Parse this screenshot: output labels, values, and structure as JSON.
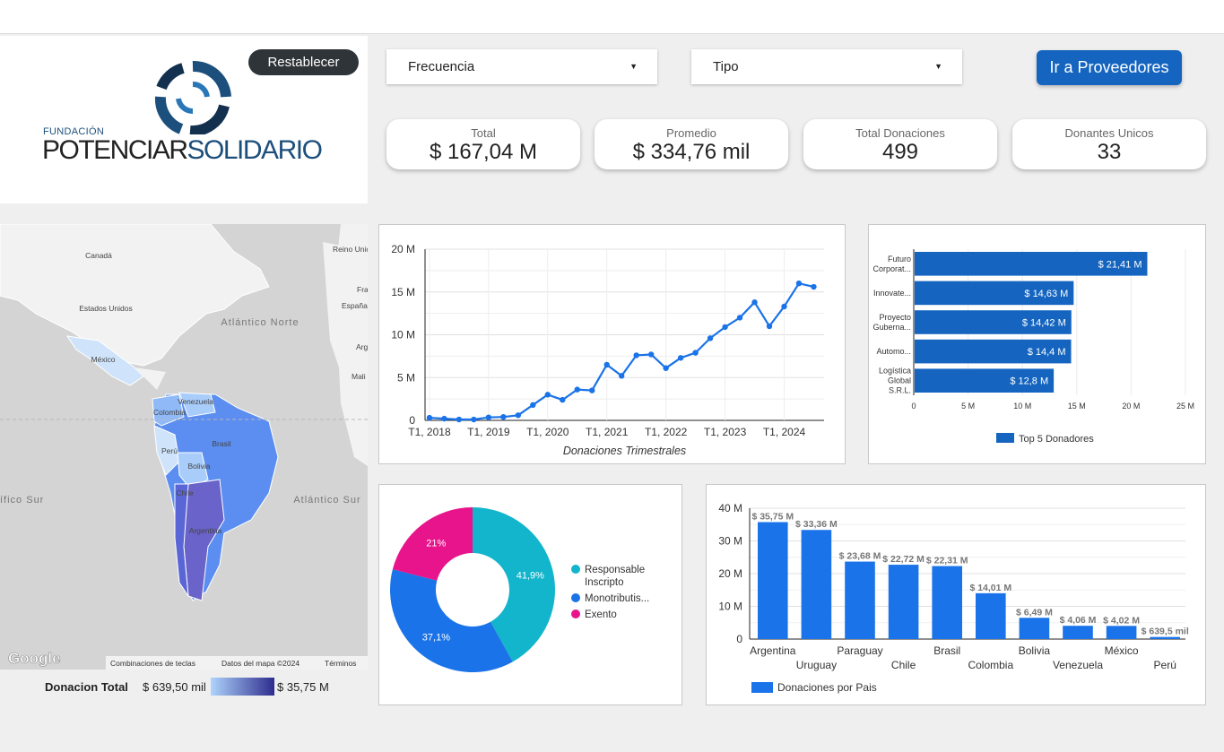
{
  "buttons": {
    "reset": "Restablecer",
    "goto": "Ir a Proveedores"
  },
  "logo": {
    "small": "FUNDACIÓN",
    "main": "POTENCIAR",
    "accent": "SOLIDARIO"
  },
  "filters": {
    "freq": "Frecuencia",
    "type": "Tipo"
  },
  "kpis": [
    {
      "label": "Total",
      "value": "$ 167,04 M"
    },
    {
      "label": "Promedio",
      "value": "$ 334,76 mil"
    },
    {
      "label": "Total Donaciones",
      "value": "499"
    },
    {
      "label": "Donantes Unicos",
      "value": "33"
    }
  ],
  "map": {
    "labels": {
      "canada": "Canadá",
      "usa": "Estados Unidos",
      "mexico": "México",
      "atl_n": "Atlántico Norte",
      "atl_s": "Atlántico Sur",
      "pac_s": "ífico Sur",
      "venezuela": "Venezuela",
      "colombia": "Colombia",
      "brasil": "Brasil",
      "peru": "Perú",
      "bolivia": "Bolivia",
      "chile": "Chile",
      "argentina": "Argentina",
      "reino": "Reino Unic",
      "fra": "Fra",
      "espana": "España",
      "arg": "Arg",
      "mali": "Mali"
    },
    "footer": {
      "google": "Google",
      "shortcuts": "Combinaciones de teclas",
      "mapdata": "Datos del mapa ©2024",
      "terms": "Términos"
    },
    "legend": {
      "title": "Donacion Total",
      "min": "$ 639,50 mil",
      "max": "$ 35,75 M",
      "color_min": "#aed4fb",
      "color_max": "#2e2c8e"
    }
  },
  "colors": {
    "blue": "#1a73e8",
    "dark_blue": "#1565c0",
    "teal": "#12b5cb",
    "pink": "#e8148b",
    "mono_blue": "#1a73e8"
  },
  "chart_data": [
    {
      "type": "line",
      "xlabel": "Donaciones Trimestrales",
      "x_ticks": [
        "T1, 2018",
        "T1, 2019",
        "T1, 2020",
        "T1, 2021",
        "T1, 2022",
        "T1, 2023",
        "T1, 2024"
      ],
      "y_ticks": [
        "0",
        "5 M",
        "10 M",
        "15 M",
        "20 M"
      ],
      "ylim": [
        0,
        20
      ],
      "grid": true,
      "x": [
        "T1 2018",
        "T2 2018",
        "T3 2018",
        "T4 2018",
        "T1 2019",
        "T2 2019",
        "T3 2019",
        "T4 2019",
        "T1 2020",
        "T2 2020",
        "T3 2020",
        "T4 2020",
        "T1 2021",
        "T2 2021",
        "T3 2021",
        "T4 2021",
        "T1 2022",
        "T2 2022",
        "T3 2022",
        "T4 2022",
        "T1 2023",
        "T2 2023",
        "T3 2023",
        "T4 2023",
        "T1 2024",
        "T2 2024",
        "T3 2024"
      ],
      "values": [
        0.3,
        0.2,
        0.1,
        0.1,
        0.35,
        0.4,
        0.6,
        1.8,
        3.0,
        2.4,
        3.6,
        3.5,
        6.5,
        5.2,
        7.6,
        7.7,
        6.1,
        7.3,
        7.9,
        9.6,
        10.9,
        12.0,
        13.8,
        11.0,
        13.3,
        16.0,
        15.6
      ]
    },
    {
      "type": "bar",
      "orientation": "horizontal",
      "legend": "Top 5 Donadores",
      "categories": [
        [
          "Futuro",
          "Corporat..."
        ],
        [
          "Innovate..."
        ],
        [
          "Proyecto",
          "Guberna..."
        ],
        [
          "Automo..."
        ],
        [
          "Logística",
          "Global",
          "S.R.L."
        ]
      ],
      "values": [
        21.41,
        14.63,
        14.42,
        14.4,
        12.8
      ],
      "labels": [
        "$ 21,41 M",
        "$ 14,63 M",
        "$ 14,42 M",
        "$ 14,4 M",
        "$ 12,8 M"
      ],
      "x_ticks": [
        "0",
        "5 M",
        "10 M",
        "15 M",
        "20 M",
        "25 M"
      ],
      "xlim": [
        0,
        25
      ]
    },
    {
      "type": "pie",
      "donut": true,
      "slices": [
        {
          "name": "Responsable Inscripto",
          "legend_lines": [
            "Responsable",
            "Inscripto"
          ],
          "value": 41.9,
          "label": "41,9%"
        },
        {
          "name": "Monotributis...",
          "legend_lines": [
            "Monotributis..."
          ],
          "value": 37.1,
          "label": "37,1%"
        },
        {
          "name": "Exento",
          "legend_lines": [
            "Exento"
          ],
          "value": 21,
          "label": "21%"
        }
      ]
    },
    {
      "type": "bar",
      "legend": "Donaciones por Pais",
      "categories": [
        "Argentina",
        "Uruguay",
        "Paraguay",
        "Chile",
        "Brasil",
        "Colombia",
        "Bolivia",
        "Venezuela",
        "México",
        "Perú"
      ],
      "values": [
        35.75,
        33.36,
        23.68,
        22.72,
        22.31,
        14.01,
        6.49,
        4.06,
        4.02,
        0.6395
      ],
      "labels": [
        "$ 35,75 M",
        "$ 33,36 M",
        "$ 23,68 M",
        "$ 22,72 M",
        "$ 22,31 M",
        "$ 14,01 M",
        "$ 6,49 M",
        "$ 4,06 M",
        "$ 4,02 M",
        "$ 639,5 mil"
      ],
      "y_ticks": [
        "0",
        "10 M",
        "20 M",
        "30 M",
        "40 M"
      ],
      "ylim": [
        0,
        40
      ]
    }
  ]
}
